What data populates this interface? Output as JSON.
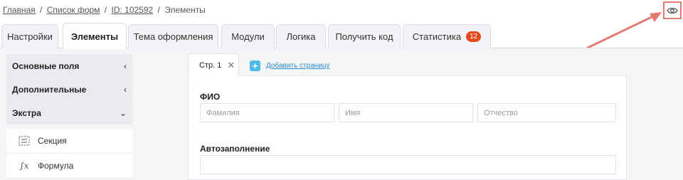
{
  "breadcrumb": {
    "home": "Главная",
    "forms": "Список форм",
    "id": "ID: 102592",
    "current": "Элементы",
    "separator": "/"
  },
  "header": {
    "preview_icon": "eye-icon"
  },
  "tabs": [
    {
      "label": "Настройки",
      "active": false
    },
    {
      "label": "Элементы",
      "active": true
    },
    {
      "label": "Тема оформления",
      "active": false
    },
    {
      "label": "Модули",
      "active": false
    },
    {
      "label": "Логика",
      "active": false
    },
    {
      "label": "Получить код",
      "active": false
    },
    {
      "label": "Статистика",
      "active": false,
      "badge": "12"
    }
  ],
  "sidebar": {
    "sections": [
      {
        "label": "Основные поля",
        "chevron": "‹",
        "state": "collapsed"
      },
      {
        "label": "Дополнительные",
        "chevron": "‹",
        "state": "collapsed"
      },
      {
        "label": "Экстра",
        "chevron": "⌄",
        "state": "expanded"
      }
    ],
    "tools": [
      {
        "label": "Секция",
        "icon": "section-icon"
      },
      {
        "label": "Формула",
        "icon": "formula-icon",
        "glyph": "∫x"
      }
    ]
  },
  "editor": {
    "page_tab": {
      "label": "Стр. 1",
      "close": "✕"
    },
    "add_page": {
      "plus": "+",
      "label": "Добавить страницу"
    },
    "fields": {
      "fio": {
        "label": "ФИО",
        "placeholders": [
          "Фамилия",
          "Имя",
          "Отчество"
        ]
      },
      "autofill": {
        "label": "Автозаполнение",
        "value": ""
      }
    }
  },
  "colors": {
    "badge": "#e34b1f",
    "highlight_box": "#e07a72",
    "accent_link": "#2a8fd0",
    "add_button": "#4fb9e8"
  }
}
